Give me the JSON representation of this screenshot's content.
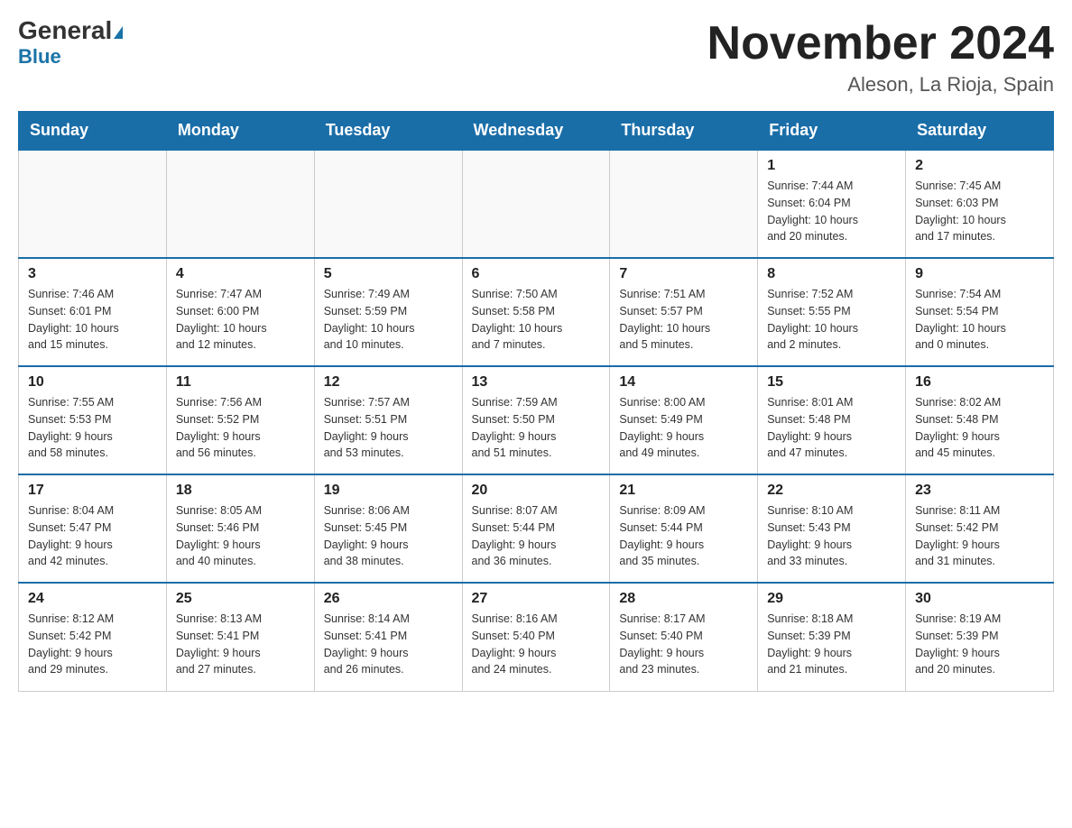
{
  "logo": {
    "general": "General",
    "blue": "Blue"
  },
  "title": "November 2024",
  "subtitle": "Aleson, La Rioja, Spain",
  "weekdays": [
    "Sunday",
    "Monday",
    "Tuesday",
    "Wednesday",
    "Thursday",
    "Friday",
    "Saturday"
  ],
  "weeks": [
    [
      {
        "day": "",
        "info": ""
      },
      {
        "day": "",
        "info": ""
      },
      {
        "day": "",
        "info": ""
      },
      {
        "day": "",
        "info": ""
      },
      {
        "day": "",
        "info": ""
      },
      {
        "day": "1",
        "info": "Sunrise: 7:44 AM\nSunset: 6:04 PM\nDaylight: 10 hours\nand 20 minutes."
      },
      {
        "day": "2",
        "info": "Sunrise: 7:45 AM\nSunset: 6:03 PM\nDaylight: 10 hours\nand 17 minutes."
      }
    ],
    [
      {
        "day": "3",
        "info": "Sunrise: 7:46 AM\nSunset: 6:01 PM\nDaylight: 10 hours\nand 15 minutes."
      },
      {
        "day": "4",
        "info": "Sunrise: 7:47 AM\nSunset: 6:00 PM\nDaylight: 10 hours\nand 12 minutes."
      },
      {
        "day": "5",
        "info": "Sunrise: 7:49 AM\nSunset: 5:59 PM\nDaylight: 10 hours\nand 10 minutes."
      },
      {
        "day": "6",
        "info": "Sunrise: 7:50 AM\nSunset: 5:58 PM\nDaylight: 10 hours\nand 7 minutes."
      },
      {
        "day": "7",
        "info": "Sunrise: 7:51 AM\nSunset: 5:57 PM\nDaylight: 10 hours\nand 5 minutes."
      },
      {
        "day": "8",
        "info": "Sunrise: 7:52 AM\nSunset: 5:55 PM\nDaylight: 10 hours\nand 2 minutes."
      },
      {
        "day": "9",
        "info": "Sunrise: 7:54 AM\nSunset: 5:54 PM\nDaylight: 10 hours\nand 0 minutes."
      }
    ],
    [
      {
        "day": "10",
        "info": "Sunrise: 7:55 AM\nSunset: 5:53 PM\nDaylight: 9 hours\nand 58 minutes."
      },
      {
        "day": "11",
        "info": "Sunrise: 7:56 AM\nSunset: 5:52 PM\nDaylight: 9 hours\nand 56 minutes."
      },
      {
        "day": "12",
        "info": "Sunrise: 7:57 AM\nSunset: 5:51 PM\nDaylight: 9 hours\nand 53 minutes."
      },
      {
        "day": "13",
        "info": "Sunrise: 7:59 AM\nSunset: 5:50 PM\nDaylight: 9 hours\nand 51 minutes."
      },
      {
        "day": "14",
        "info": "Sunrise: 8:00 AM\nSunset: 5:49 PM\nDaylight: 9 hours\nand 49 minutes."
      },
      {
        "day": "15",
        "info": "Sunrise: 8:01 AM\nSunset: 5:48 PM\nDaylight: 9 hours\nand 47 minutes."
      },
      {
        "day": "16",
        "info": "Sunrise: 8:02 AM\nSunset: 5:48 PM\nDaylight: 9 hours\nand 45 minutes."
      }
    ],
    [
      {
        "day": "17",
        "info": "Sunrise: 8:04 AM\nSunset: 5:47 PM\nDaylight: 9 hours\nand 42 minutes."
      },
      {
        "day": "18",
        "info": "Sunrise: 8:05 AM\nSunset: 5:46 PM\nDaylight: 9 hours\nand 40 minutes."
      },
      {
        "day": "19",
        "info": "Sunrise: 8:06 AM\nSunset: 5:45 PM\nDaylight: 9 hours\nand 38 minutes."
      },
      {
        "day": "20",
        "info": "Sunrise: 8:07 AM\nSunset: 5:44 PM\nDaylight: 9 hours\nand 36 minutes."
      },
      {
        "day": "21",
        "info": "Sunrise: 8:09 AM\nSunset: 5:44 PM\nDaylight: 9 hours\nand 35 minutes."
      },
      {
        "day": "22",
        "info": "Sunrise: 8:10 AM\nSunset: 5:43 PM\nDaylight: 9 hours\nand 33 minutes."
      },
      {
        "day": "23",
        "info": "Sunrise: 8:11 AM\nSunset: 5:42 PM\nDaylight: 9 hours\nand 31 minutes."
      }
    ],
    [
      {
        "day": "24",
        "info": "Sunrise: 8:12 AM\nSunset: 5:42 PM\nDaylight: 9 hours\nand 29 minutes."
      },
      {
        "day": "25",
        "info": "Sunrise: 8:13 AM\nSunset: 5:41 PM\nDaylight: 9 hours\nand 27 minutes."
      },
      {
        "day": "26",
        "info": "Sunrise: 8:14 AM\nSunset: 5:41 PM\nDaylight: 9 hours\nand 26 minutes."
      },
      {
        "day": "27",
        "info": "Sunrise: 8:16 AM\nSunset: 5:40 PM\nDaylight: 9 hours\nand 24 minutes."
      },
      {
        "day": "28",
        "info": "Sunrise: 8:17 AM\nSunset: 5:40 PM\nDaylight: 9 hours\nand 23 minutes."
      },
      {
        "day": "29",
        "info": "Sunrise: 8:18 AM\nSunset: 5:39 PM\nDaylight: 9 hours\nand 21 minutes."
      },
      {
        "day": "30",
        "info": "Sunrise: 8:19 AM\nSunset: 5:39 PM\nDaylight: 9 hours\nand 20 minutes."
      }
    ]
  ]
}
